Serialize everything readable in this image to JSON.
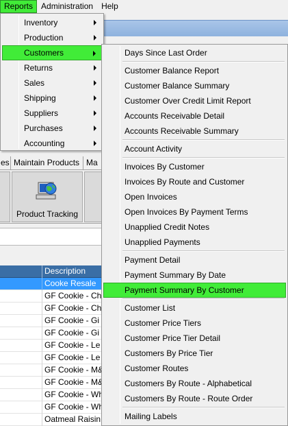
{
  "menubar": {
    "items": [
      {
        "label": "Reports",
        "active": true
      },
      {
        "label": "Administration",
        "active": false
      },
      {
        "label": "Help",
        "active": false
      }
    ]
  },
  "reports_menu": {
    "items": [
      {
        "label": "Inventory"
      },
      {
        "label": "Production"
      },
      {
        "label": "Customers"
      },
      {
        "label": "Returns"
      },
      {
        "label": "Sales"
      },
      {
        "label": "Shipping"
      },
      {
        "label": "Suppliers"
      },
      {
        "label": "Purchases"
      },
      {
        "label": "Accounting"
      }
    ],
    "active_index": 2
  },
  "customers_menu": {
    "items": [
      "Days Since Last Order",
      "Customer Balance Report",
      "Customer Balance Summary",
      "Customer Over Credit Limit Report",
      "Accounts Receivable Detail",
      "Accounts Receivable Summary",
      "Account Activity",
      "Invoices By Customer",
      "Invoices By Route and Customer",
      "Open Invoices",
      "Open Invoices By Payment Terms",
      "Unapplied Credit Notes",
      "Unapplied Payments",
      "Payment Detail",
      "Payment Summary By Date",
      "Payment Summary By Customer",
      "Customer List",
      "Customer Price Tiers",
      "Customer Price Tier Detail",
      "Customers By Price Tier",
      "Customer Routes",
      "Customers By Route - Alphabetical",
      "Customers By Route - Route Order",
      "Mailing Labels"
    ],
    "active_label": "Payment Summary By Customer"
  },
  "tabs": [
    "es",
    "Maintain Products",
    "Ma"
  ],
  "toolbar": {
    "product_tracking_label": "Product Tracking"
  },
  "grid": {
    "header": [
      "",
      "Description"
    ],
    "rows": [
      "Cooke Resale",
      "GF Cookie - Ch",
      "GF Cookie - Ch",
      "GF Cookie - Gi",
      "GF Cookie - Gi",
      "GF Cookie - Le",
      "GF Cookie - Le",
      "GF Cookie - M&",
      "GF Cookie - M&",
      "GF Cookie - Wh",
      "GF Cookie - Wh",
      "Oatmeal Raisin"
    ],
    "selected_index": 0
  },
  "colors": {
    "highlight": "#41ec38",
    "grid_header": "#3a6ea5",
    "selection": "#3399ff"
  }
}
